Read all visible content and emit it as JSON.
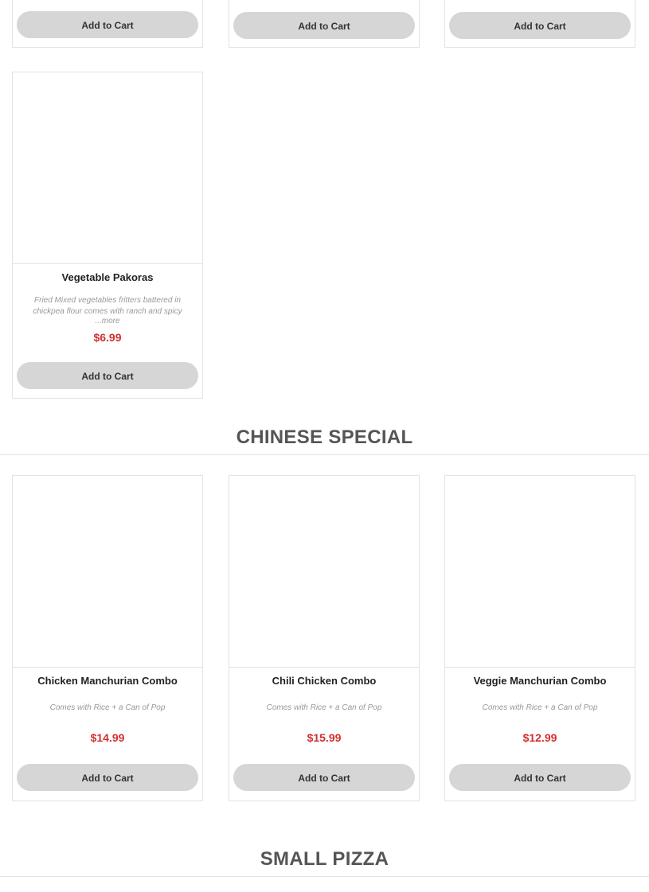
{
  "top_row": {
    "cards": [
      {
        "cart_label": "Add to Cart"
      },
      {
        "cart_label": "Add to Cart"
      },
      {
        "cart_label": "Add to Cart"
      }
    ]
  },
  "appetizer_row": {
    "cards": [
      {
        "name": "Vegetable Pakoras",
        "description": "Fried Mixed vegetables fritters battered in chickpea flour comes with ranch and spicy",
        "more_label": "...more",
        "price": "$6.99",
        "cart_label": "Add to Cart"
      }
    ]
  },
  "chinese_special": {
    "title": "CHINESE SPECIAL",
    "cards": [
      {
        "name": "Chicken Manchurian Combo",
        "description": "Comes with Rice + a Can of Pop",
        "price": "$14.99",
        "cart_label": "Add to Cart"
      },
      {
        "name": "Chili Chicken Combo",
        "description": "Comes with Rice + a Can of Pop",
        "price": "$15.99",
        "cart_label": "Add to Cart"
      },
      {
        "name": "Veggie Manchurian Combo",
        "description": "Comes with Rice + a Can of Pop",
        "price": "$12.99",
        "cart_label": "Add to Cart"
      }
    ]
  },
  "small_pizza": {
    "title": "SMALL PIZZA"
  },
  "colors": {
    "price": "#d32f2f",
    "button_bg": "#d6d6d6",
    "section_title": "#555555"
  }
}
